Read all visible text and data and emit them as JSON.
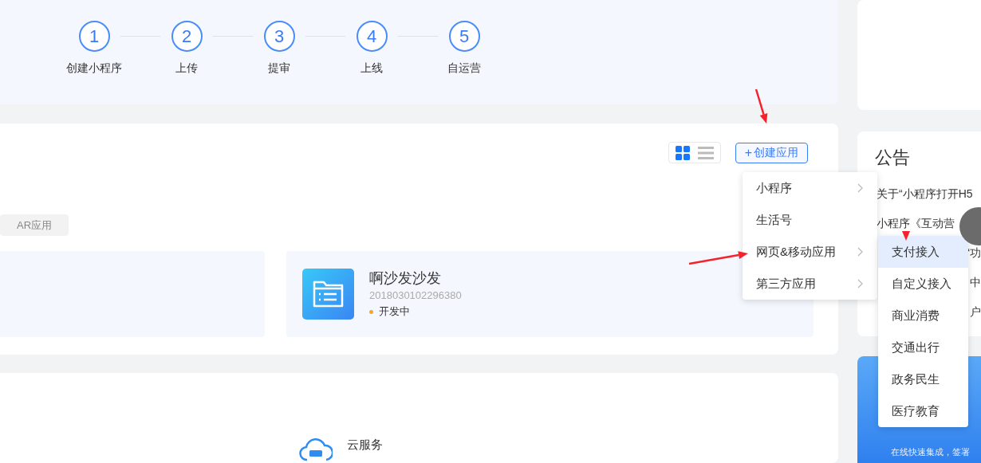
{
  "steps": [
    {
      "number": "1",
      "label": "创建小程序"
    },
    {
      "number": "2",
      "label": "上传"
    },
    {
      "number": "3",
      "label": "提审"
    },
    {
      "number": "4",
      "label": "上线"
    },
    {
      "number": "5",
      "label": "自运营"
    }
  ],
  "view_toggle": [
    {
      "kind": "grid",
      "selected": true
    },
    {
      "kind": "list",
      "selected": false
    }
  ],
  "create_button": {
    "icon": "+",
    "label": "创建应用"
  },
  "filter_tags": [
    {
      "label": "AR应用",
      "selected": false
    }
  ],
  "apps": [
    {
      "name": "啊沙发沙发",
      "id": "2018030102296380",
      "status": "开发中",
      "color": "#f5a623"
    }
  ],
  "services": [
    {
      "name": "云服务"
    }
  ],
  "announcements": {
    "title": "公告",
    "items": [
      {
        "text": "关于“小程序打开H5",
        "covered": false
      },
      {
        "text": "小程序《互动营",
        "covered": false
      },
      {
        "text": "“功",
        "covered": true
      },
      {
        "text": "中",
        "covered": true
      },
      {
        "text": "户",
        "covered": true
      }
    ]
  },
  "banner": {
    "text": "在线快速集成，签署"
  },
  "menu": {
    "items": [
      {
        "label": "小程序",
        "has_submenu": true
      },
      {
        "label": "生活号",
        "has_submenu": false
      },
      {
        "label": "网页&移动应用",
        "has_submenu": true
      },
      {
        "label": "第三方应用",
        "has_submenu": true
      }
    ]
  },
  "submenu": {
    "items": [
      {
        "label": "支付接入",
        "selected": true
      },
      {
        "label": "自定义接入",
        "selected": false
      },
      {
        "label": "商业消费",
        "selected": false
      },
      {
        "label": "交通出行",
        "selected": false
      },
      {
        "label": "政务民生",
        "selected": false
      },
      {
        "label": "医疗教育",
        "selected": false
      }
    ]
  }
}
